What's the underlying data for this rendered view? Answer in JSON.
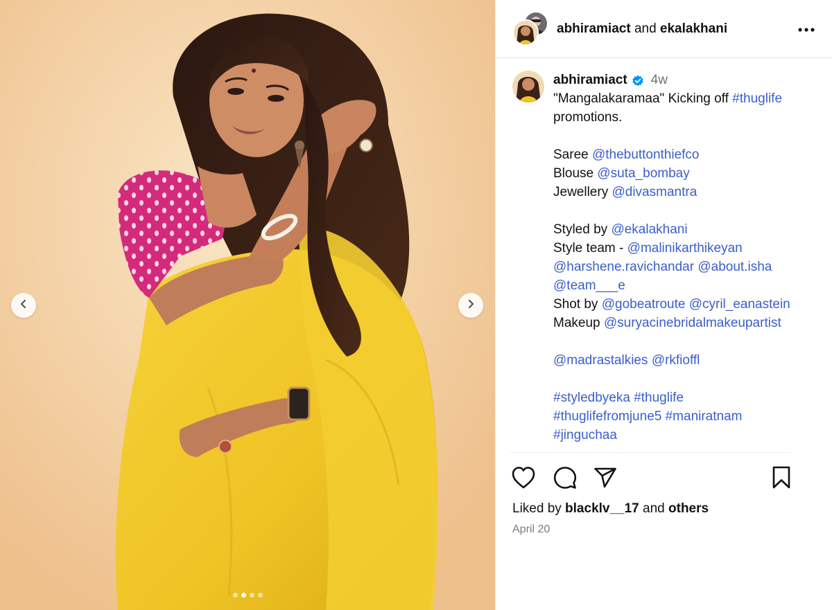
{
  "header": {
    "user1": "abhiramiact",
    "conjunction": "and",
    "user2": "ekalakhani",
    "more_icon": "more-horizontal-icon"
  },
  "caption": {
    "username": "abhiramiact",
    "verified_icon": "verified-badge-icon",
    "age": "4w",
    "lines": {
      "l1_text": "\"Mangalakaramaa\" Kicking off ",
      "l1_tag": "#thuglife",
      "l2_text": "promotions.",
      "saree_label": "Saree ",
      "saree_handle": "@thebuttonthiefco",
      "blouse_label": "Blouse ",
      "blouse_handle": "@suta_bombay",
      "jewellery_label": "Jewellery ",
      "jewellery_handle": "@divasmantra",
      "styled_label": "Styled by ",
      "styled_handle": "@ekalakhani",
      "team_label": "Style team - ",
      "team_handle1": "@malinikarthikeyan",
      "team_handle2": "@harshene.ravichandar",
      "team_handle3": "@about.isha",
      "team_handle4": "@team___e",
      "shot_label": "Shot by ",
      "shot_handle1": "@gobeatroute",
      "shot_handle2": "@cyril_eanastein",
      "makeup_label": "Makeup ",
      "makeup_handle": "@suryacinebridalmakeupartist",
      "credit1": "@madrastalkies",
      "credit2": "@rkfioffl",
      "tag1": "#styledbyeka",
      "tag2": "#thuglife",
      "tag3": "#thuglifefromjune5",
      "tag4": "#maniratnam",
      "tag5": "#jinguchaa"
    }
  },
  "actions": {
    "like_icon": "heart-icon",
    "comment_icon": "comment-icon",
    "share_icon": "send-icon",
    "save_icon": "bookmark-icon"
  },
  "likes": {
    "prefix": "Liked by ",
    "user": "blacklv__17",
    "middle": " and ",
    "others": "others"
  },
  "date": "April 20",
  "carousel": {
    "prev_icon": "chevron-left-icon",
    "next_icon": "chevron-right-icon",
    "slide_count": 4,
    "active_index": 1
  },
  "colors": {
    "link": "#3a5ecb",
    "verified": "#0095f6",
    "background_warm": "#f2cf9e",
    "saree": "#f2c62a",
    "blouse": "#d4287a"
  }
}
